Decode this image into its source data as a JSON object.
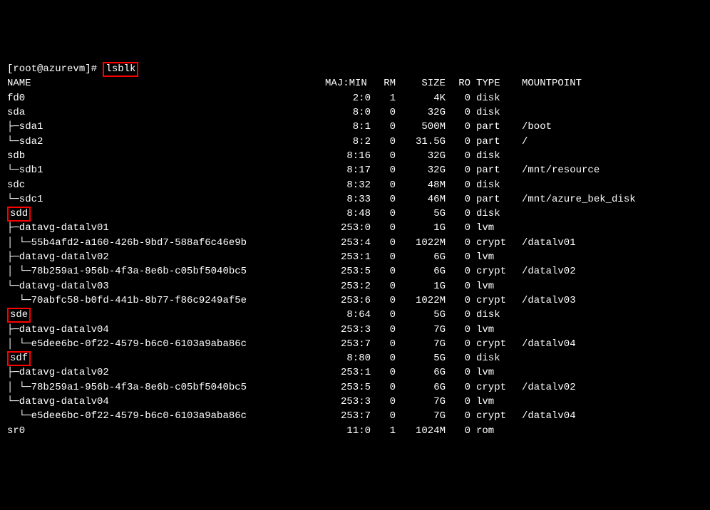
{
  "prompt_prefix": "[root@azurevm]# ",
  "command": "lsblk",
  "header": {
    "name": "NAME",
    "majmin": "MAJ:MIN",
    "rm": "RM",
    "size": "SIZE",
    "ro": "RO",
    "type": "TYPE",
    "mount": "MOUNTPOINT"
  },
  "rows": [
    {
      "tree": "fd0",
      "maj": "2:0",
      "rm": "1",
      "size": "4K",
      "ro": "0",
      "type": "disk",
      "mount": "",
      "hl": false
    },
    {
      "tree": "sda",
      "maj": "8:0",
      "rm": "0",
      "size": "32G",
      "ro": "0",
      "type": "disk",
      "mount": "",
      "hl": false
    },
    {
      "tree": "├─sda1",
      "maj": "8:1",
      "rm": "0",
      "size": "500M",
      "ro": "0",
      "type": "part",
      "mount": "/boot",
      "hl": false
    },
    {
      "tree": "└─sda2",
      "maj": "8:2",
      "rm": "0",
      "size": "31.5G",
      "ro": "0",
      "type": "part",
      "mount": "/",
      "hl": false
    },
    {
      "tree": "sdb",
      "maj": "8:16",
      "rm": "0",
      "size": "32G",
      "ro": "0",
      "type": "disk",
      "mount": "",
      "hl": false
    },
    {
      "tree": "└─sdb1",
      "maj": "8:17",
      "rm": "0",
      "size": "32G",
      "ro": "0",
      "type": "part",
      "mount": "/mnt/resource",
      "hl": false
    },
    {
      "tree": "sdc",
      "maj": "8:32",
      "rm": "0",
      "size": "48M",
      "ro": "0",
      "type": "disk",
      "mount": "",
      "hl": false
    },
    {
      "tree": "└─sdc1",
      "maj": "8:33",
      "rm": "0",
      "size": "46M",
      "ro": "0",
      "type": "part",
      "mount": "/mnt/azure_bek_disk",
      "hl": false
    },
    {
      "tree": "sdd",
      "maj": "8:48",
      "rm": "0",
      "size": "5G",
      "ro": "0",
      "type": "disk",
      "mount": "",
      "hl": true
    },
    {
      "tree": "├─datavg-datalv01",
      "maj": "253:0",
      "rm": "0",
      "size": "1G",
      "ro": "0",
      "type": "lvm",
      "mount": "",
      "hl": false
    },
    {
      "tree": "│ └─55b4afd2-a160-426b-9bd7-588af6c46e9b",
      "maj": "253:4",
      "rm": "0",
      "size": "1022M",
      "ro": "0",
      "type": "crypt",
      "mount": "/datalv01",
      "hl": false
    },
    {
      "tree": "├─datavg-datalv02",
      "maj": "253:1",
      "rm": "0",
      "size": "6G",
      "ro": "0",
      "type": "lvm",
      "mount": "",
      "hl": false
    },
    {
      "tree": "│ └─78b259a1-956b-4f3a-8e6b-c05bf5040bc5",
      "maj": "253:5",
      "rm": "0",
      "size": "6G",
      "ro": "0",
      "type": "crypt",
      "mount": "/datalv02",
      "hl": false
    },
    {
      "tree": "└─datavg-datalv03",
      "maj": "253:2",
      "rm": "0",
      "size": "1G",
      "ro": "0",
      "type": "lvm",
      "mount": "",
      "hl": false
    },
    {
      "tree": "  └─70abfc58-b0fd-441b-8b77-f86c9249af5e",
      "maj": "253:6",
      "rm": "0",
      "size": "1022M",
      "ro": "0",
      "type": "crypt",
      "mount": "/datalv03",
      "hl": false
    },
    {
      "tree": "sde",
      "maj": "8:64",
      "rm": "0",
      "size": "5G",
      "ro": "0",
      "type": "disk",
      "mount": "",
      "hl": true
    },
    {
      "tree": "├─datavg-datalv04",
      "maj": "253:3",
      "rm": "0",
      "size": "7G",
      "ro": "0",
      "type": "lvm",
      "mount": "",
      "hl": false
    },
    {
      "tree": "│ └─e5dee6bc-0f22-4579-b6c0-6103a9aba86c",
      "maj": "253:7",
      "rm": "0",
      "size": "7G",
      "ro": "0",
      "type": "crypt",
      "mount": "/datalv04",
      "hl": false
    },
    {
      "tree": "sdf",
      "maj": "8:80",
      "rm": "0",
      "size": "5G",
      "ro": "0",
      "type": "disk",
      "mount": "",
      "hl": true
    },
    {
      "tree": "├─datavg-datalv02",
      "maj": "253:1",
      "rm": "0",
      "size": "6G",
      "ro": "0",
      "type": "lvm",
      "mount": "",
      "hl": false
    },
    {
      "tree": "│ └─78b259a1-956b-4f3a-8e6b-c05bf5040bc5",
      "maj": "253:5",
      "rm": "0",
      "size": "6G",
      "ro": "0",
      "type": "crypt",
      "mount": "/datalv02",
      "hl": false
    },
    {
      "tree": "└─datavg-datalv04",
      "maj": "253:3",
      "rm": "0",
      "size": "7G",
      "ro": "0",
      "type": "lvm",
      "mount": "",
      "hl": false
    },
    {
      "tree": "  └─e5dee6bc-0f22-4579-b6c0-6103a9aba86c",
      "maj": "253:7",
      "rm": "0",
      "size": "7G",
      "ro": "0",
      "type": "crypt",
      "mount": "/datalv04",
      "hl": false
    },
    {
      "tree": "sr0",
      "maj": "11:0",
      "rm": "1",
      "size": "1024M",
      "ro": "0",
      "type": "rom",
      "mount": "",
      "hl": false
    }
  ]
}
